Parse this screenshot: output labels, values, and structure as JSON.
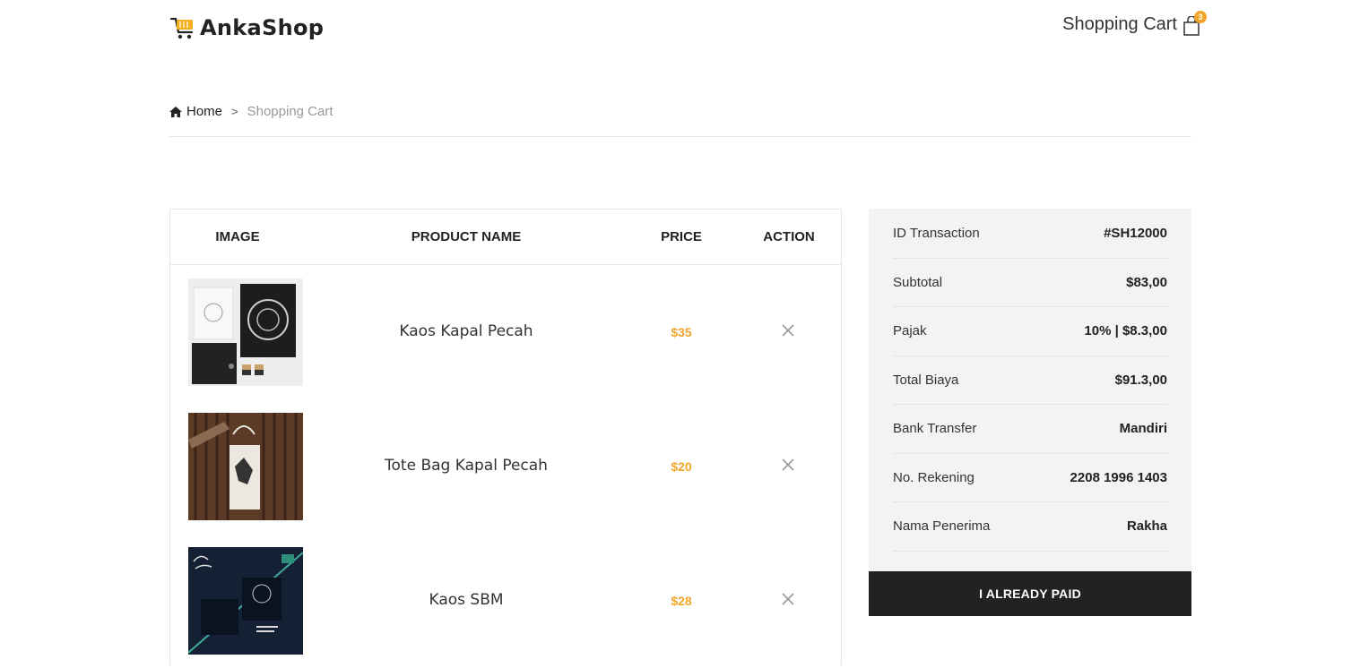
{
  "brand": {
    "name": "AnkaShop"
  },
  "header": {
    "cart_label": "Shopping Cart",
    "cart_count": "3"
  },
  "breadcrumb": {
    "home": "Home",
    "separator": ">",
    "current": "Shopping Cart"
  },
  "table": {
    "columns": [
      "IMAGE",
      "PRODUCT NAME",
      "PRICE",
      "ACTION"
    ],
    "rows": [
      {
        "name": "Kaos Kapal Pecah",
        "price": "$35"
      },
      {
        "name": "Tote Bag Kapal Pecah",
        "price": "$20"
      },
      {
        "name": "Kaos SBM",
        "price": "$28"
      }
    ]
  },
  "summary": {
    "rows": [
      {
        "label": "ID Transaction",
        "value": "#SH12000"
      },
      {
        "label": "Subtotal",
        "value": "$83,00"
      },
      {
        "label": "Pajak",
        "value": "10% | $8.3,00"
      },
      {
        "label": "Total Biaya",
        "value": "$91.3,00"
      },
      {
        "label": "Bank Transfer",
        "value": "Mandiri"
      },
      {
        "label": "No. Rekening",
        "value": "2208 1996 1403"
      },
      {
        "label": "Nama Penerima",
        "value": "Rakha"
      }
    ],
    "button_label": "I ALREADY PAID"
  },
  "colors": {
    "accent": "#f2a52a",
    "dark": "#222222",
    "summary_bg": "#f3f3f3"
  }
}
